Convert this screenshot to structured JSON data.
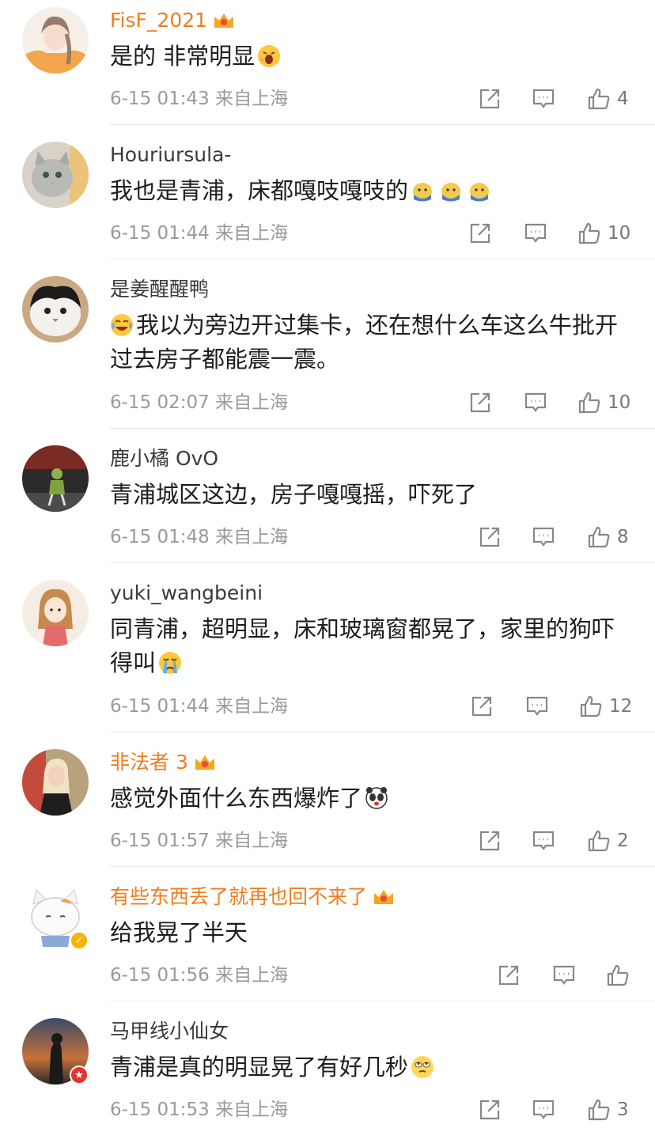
{
  "comments": [
    {
      "user": "FisF_2021",
      "vip": true,
      "text": "是的 非常明显",
      "emojis": [
        "yawn"
      ],
      "time": "6-15 01:43",
      "location": "来自上海",
      "likes": "4"
    },
    {
      "user": "Houriursula-",
      "vip": false,
      "text": "我也是青浦，床都嘎吱嘎吱的",
      "emojis": [
        "doge",
        "doge",
        "doge"
      ],
      "time": "6-15 01:44",
      "location": "来自上海",
      "likes": "10"
    },
    {
      "user": "是姜醒醒鸭",
      "vip": false,
      "text_prefix_emoji": "laugh-cry",
      "text": "我以为旁边开过集卡，还在想什么车这么牛批开过去房子都能震一震。",
      "time": "6-15 02:07",
      "location": "来自上海",
      "likes": "10"
    },
    {
      "user": "鹿小橘 OvO",
      "vip": false,
      "text": "青浦城区这边，房子嘎嘎摇，吓死了",
      "time": "6-15 01:48",
      "location": "来自上海",
      "likes": "8"
    },
    {
      "user": "yuki_wangbeini",
      "vip": false,
      "text": "同青浦，超明显，床和玻璃窗都晃了，家里的狗吓得叫",
      "emojis": [
        "crying"
      ],
      "time": "6-15 01:44",
      "location": "来自上海",
      "likes": "12"
    },
    {
      "user": "非法者 3",
      "vip": true,
      "text": "感觉外面什么东西爆炸了",
      "emojis": [
        "panda"
      ],
      "time": "6-15 01:57",
      "location": "来自上海",
      "likes": "2"
    },
    {
      "user": "有些东西丢了就再也回不来了",
      "vip": true,
      "badge": "v",
      "text": "给我晃了半天",
      "time": "6-15 01:56",
      "location": "来自上海",
      "likes": ""
    },
    {
      "user": "马甲线小仙女",
      "vip": false,
      "badge": "r",
      "text": "青浦是真的明显晃了有好几秒",
      "emojis": [
        "eyeroll"
      ],
      "time": "6-15 01:53",
      "location": "来自上海",
      "likes": "3"
    }
  ],
  "colors": {
    "vip_name": "#ee7e1e",
    "name": "#3a3a3a",
    "meta": "#9a9a9a",
    "badge_v": "#f5b400",
    "badge_r": "#e5322d"
  },
  "icons": {
    "share": "share-icon",
    "comment": "comment-icon",
    "like": "thumbs-up-icon"
  }
}
